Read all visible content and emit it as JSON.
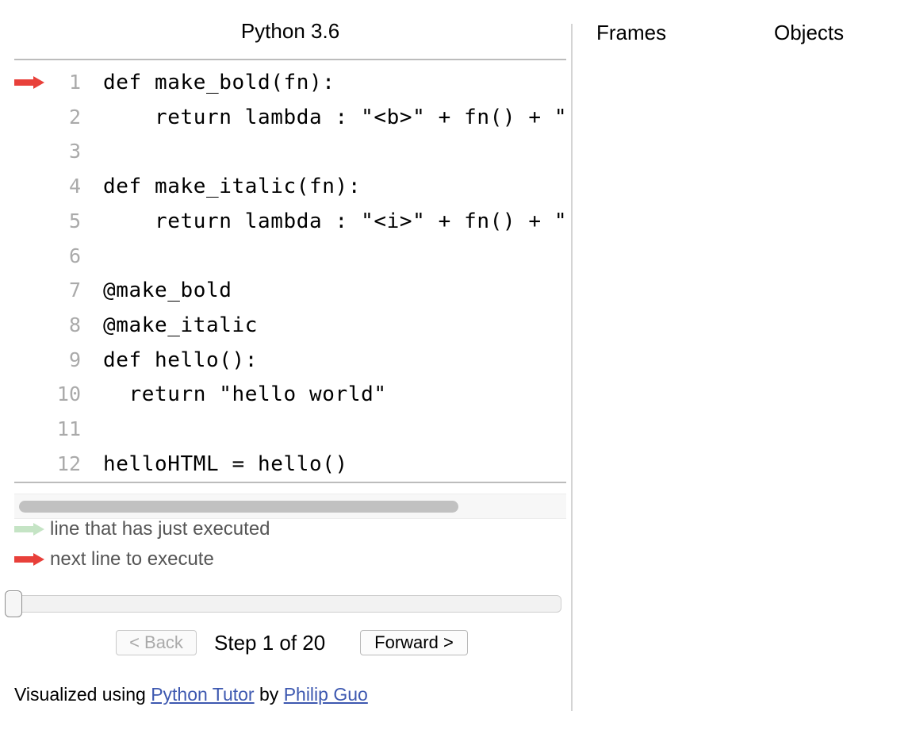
{
  "code_pane": {
    "language_title": "Python 3.6",
    "lines": [
      {
        "number": "1",
        "text": "def make_bold(fn):"
      },
      {
        "number": "2",
        "text": "    return lambda : \"<b>\" + fn() + \"</b>\""
      },
      {
        "number": "3",
        "text": ""
      },
      {
        "number": "4",
        "text": "def make_italic(fn):"
      },
      {
        "number": "5",
        "text": "    return lambda : \"<i>\" + fn() + \"</i>\""
      },
      {
        "number": "6",
        "text": ""
      },
      {
        "number": "7",
        "text": "@make_bold"
      },
      {
        "number": "8",
        "text": "@make_italic"
      },
      {
        "number": "9",
        "text": "def hello():"
      },
      {
        "number": "10",
        "text": "  return \"hello world\""
      },
      {
        "number": "11",
        "text": ""
      },
      {
        "number": "12",
        "text": "helloHTML = hello()"
      }
    ],
    "next_line_number": 1,
    "horizontal_scroll_fraction": 0.81
  },
  "legend": {
    "just_executed": "line that has just executed",
    "next_to_execute": "next line to execute"
  },
  "colors": {
    "next_line_arrow": "#e8403a",
    "just_executed_arrow": "#c5e4c5",
    "link": "#3d58b0"
  },
  "navigation": {
    "back_label": "< Back",
    "forward_label": "Forward >",
    "step_label": "Step 1 of 20",
    "current_step": 1,
    "total_steps": 20
  },
  "credit": {
    "prefix": "Visualized using",
    "tool_link": "Python Tutor",
    "middle": "by",
    "author_link": "Philip Guo"
  },
  "visualization_pane": {
    "frames_header": "Frames",
    "objects_header": "Objects"
  }
}
